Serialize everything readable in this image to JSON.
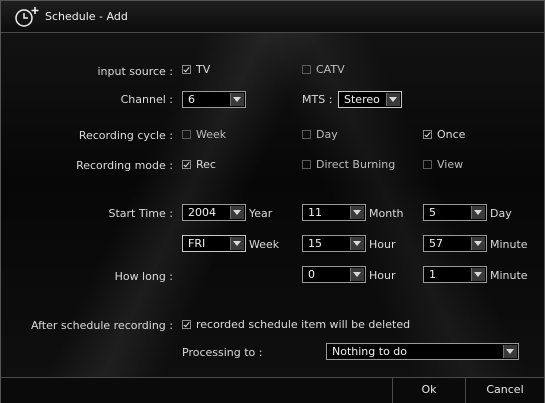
{
  "window": {
    "title": "Schedule - Add"
  },
  "labels": {
    "input_source": "input source :",
    "channel": "Channel :",
    "recording_cycle": "Recording cycle :",
    "recording_mode": "Recording mode :",
    "start_time": "Start Time :",
    "how_long": "How long :",
    "after_schedule": "After schedule recording :",
    "processing_to": "Processing to :"
  },
  "input_source": {
    "tv": {
      "label": "TV",
      "checked": true
    },
    "catv": {
      "label": "CATV",
      "checked": false
    }
  },
  "channel": {
    "value": "6",
    "mts_label": "MTS :",
    "mts_value": "Stereo"
  },
  "recording_cycle": {
    "week": {
      "label": "Week",
      "checked": false
    },
    "day": {
      "label": "Day",
      "checked": false
    },
    "once": {
      "label": "Once",
      "checked": true
    }
  },
  "recording_mode": {
    "rec": {
      "label": "Rec",
      "checked": true
    },
    "direct_burning": {
      "label": "Direct Burning",
      "checked": false
    },
    "view": {
      "label": "View",
      "checked": false
    }
  },
  "start_time": {
    "year": "2004",
    "year_unit": "Year",
    "month": "11",
    "month_unit": "Month",
    "day": "5",
    "day_unit": "Day",
    "weekday": "FRI",
    "weekday_unit": "Week",
    "hour": "15",
    "hour_unit": "Hour",
    "minute": "57",
    "minute_unit": "Minute"
  },
  "how_long": {
    "hour": "0",
    "hour_unit": "Hour",
    "minute": "1",
    "minute_unit": "Minute"
  },
  "after": {
    "delete_item": {
      "label": "recorded schedule item will be deleted",
      "checked": true
    },
    "processing_value": "Nothing to do"
  },
  "buttons": {
    "ok": "Ok",
    "cancel": "Cancel"
  },
  "colors": {
    "background": "#000000",
    "text": "#e4e4e4",
    "border": "#9a9a9a"
  },
  "icons": {
    "title": "clock-plus-icon",
    "dropdown": "triangle-down-icon",
    "checkbox": "checkbox-icon"
  }
}
